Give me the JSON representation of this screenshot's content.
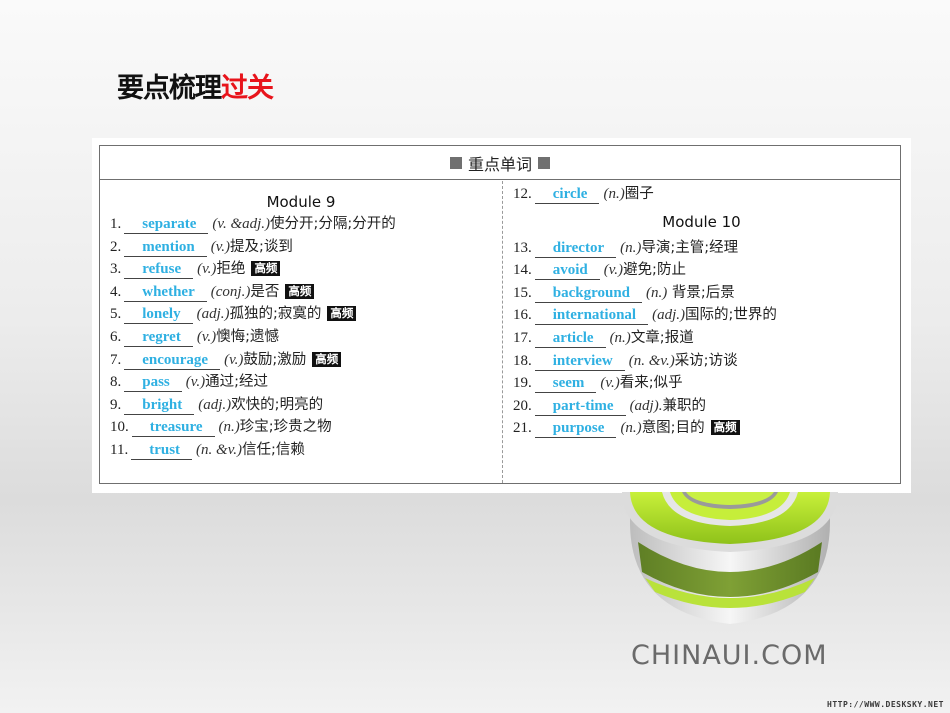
{
  "title": {
    "main": "要点梳理",
    "accent": "过关"
  },
  "accent_color": "#e8141b",
  "word_color": "#2fb0e2",
  "table": {
    "header": "重点单词",
    "header_icon": "square-bullet-icon",
    "left": {
      "module": "Module 9",
      "rows": [
        {
          "num": "1.",
          "word": "separate",
          "pos": "(v. &adj.)",
          "meaning": "使分开;分隔;分开的",
          "badge": ""
        },
        {
          "num": "2.",
          "word": "mention",
          "pos": "(v.)",
          "meaning": "提及;谈到",
          "badge": ""
        },
        {
          "num": "3.",
          "word": "refuse",
          "pos": "(v.)",
          "meaning": "拒绝",
          "badge": "高频"
        },
        {
          "num": "4.",
          "word": "whether",
          "pos": "(conj.)",
          "meaning": "是否",
          "badge": "高频"
        },
        {
          "num": "5.",
          "word": "lonely",
          "pos": "(adj.)",
          "meaning": "孤独的;寂寞的",
          "badge": "高频"
        },
        {
          "num": "6.",
          "word": "regret",
          "pos": "(v.)",
          "meaning": "懊悔;遗憾",
          "badge": ""
        },
        {
          "num": "7.",
          "word": "encourage",
          "pos": "(v.)",
          "meaning": "鼓励;激励",
          "badge": "高频"
        },
        {
          "num": "8.",
          "word": "pass",
          "pos": "(v.)",
          "meaning": "通过;经过",
          "badge": ""
        },
        {
          "num": "9.",
          "word": "bright",
          "pos": "(adj.)",
          "meaning": "欢快的;明亮的",
          "badge": ""
        },
        {
          "num": "10.",
          "word": "treasure",
          "pos": "(n.)",
          "meaning": "珍宝;珍贵之物",
          "badge": ""
        },
        {
          "num": "11.",
          "word": "trust",
          "pos": "(n. &v.)",
          "meaning": "信任;信赖",
          "badge": ""
        }
      ]
    },
    "right": {
      "pre_rows": [
        {
          "num": "12.",
          "word": "circle",
          "pos": "(n.)",
          "meaning": "圈子",
          "badge": ""
        }
      ],
      "module": "Module 10",
      "rows": [
        {
          "num": "13.",
          "word": "director",
          "pos": "(n.)",
          "meaning": "导演;主管;经理",
          "badge": ""
        },
        {
          "num": "14.",
          "word": "avoid",
          "pos": "(v.)",
          "meaning": "避免;防止",
          "badge": ""
        },
        {
          "num": "15.",
          "word": "background",
          "pos": "(n.)",
          "meaning": " 背景;后景",
          "badge": ""
        },
        {
          "num": "16.",
          "word": "international",
          "pos": "(adj.)",
          "meaning": "国际的;世界的",
          "badge": ""
        },
        {
          "num": "17.",
          "word": "article",
          "pos": "(n.)",
          "meaning": "文章;报道",
          "badge": ""
        },
        {
          "num": "18.",
          "word": "interview",
          "pos": "(n. &v.)",
          "meaning": "采访;访谈",
          "badge": ""
        },
        {
          "num": "19.",
          "word": "seem",
          "pos": "(v.)",
          "meaning": "看来;似乎",
          "badge": ""
        },
        {
          "num": "20.",
          "word": "part-time",
          "pos": "(adj).",
          "meaning": "兼职的",
          "badge": ""
        },
        {
          "num": "21.",
          "word": "purpose",
          "pos": "(n.)",
          "meaning": "意图;目的",
          "badge": "高频"
        }
      ]
    }
  },
  "logo": {
    "text": "CHINAUI.COM",
    "icon": "green-disc-logo-icon"
  },
  "watermark": "HTTP://WWW.DESKSKY.NET"
}
